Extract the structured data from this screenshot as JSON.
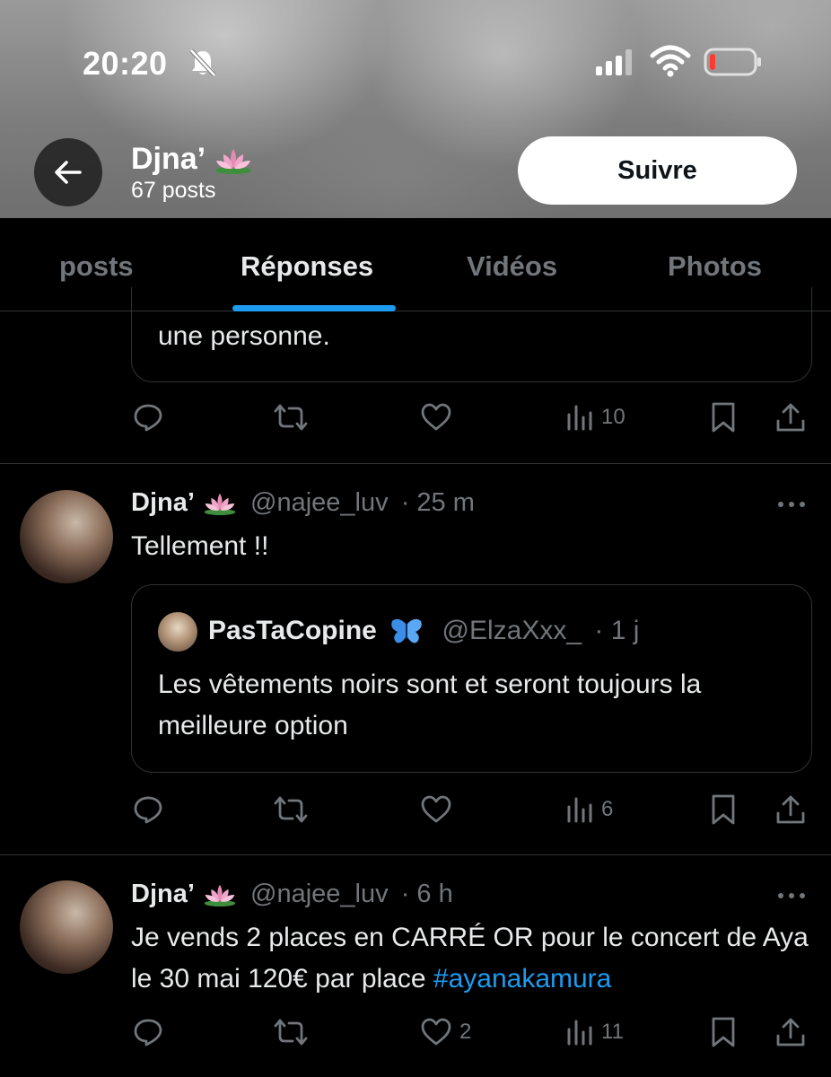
{
  "status_bar": {
    "time": "20:20"
  },
  "profile": {
    "name": "Djna’",
    "posts_count": "67 posts",
    "follow_label": "Suivre"
  },
  "tabs": [
    {
      "label": "posts",
      "active": false
    },
    {
      "label": "Réponses",
      "active": true
    },
    {
      "label": "Vidéos",
      "active": false
    },
    {
      "label": "Photos",
      "active": false
    }
  ],
  "previous_post": {
    "quote_text_tail": "une personne.",
    "views": "10"
  },
  "posts": [
    {
      "name": "Djna’",
      "handle": "@najee_luv",
      "time": "· 25 m",
      "text": "Tellement !!",
      "quote": {
        "name": "PasTaCopine",
        "handle": "@ElzaXxx_",
        "time": "· 1 j",
        "text": "Les vêtements noirs sont et seront toujours la meilleure option"
      },
      "likes": "",
      "views": "6"
    },
    {
      "name": "Djna’",
      "handle": "@najee_luv",
      "time": "· 6 h",
      "text": "Je vends 2 places en CARRÉ OR pour le concert de Aya le 30 mai 120€ par place ",
      "hashtag": "#ayanakamura",
      "likes": "2",
      "views": "11"
    }
  ],
  "colors": {
    "accent": "#1d9bf0",
    "muted": "#71767b",
    "divider": "#2f3336",
    "battery_low": "#ff3b30"
  },
  "icons": [
    "bell-off-icon",
    "signal-icon",
    "wifi-icon",
    "battery-icon",
    "back-arrow-icon",
    "lotus-icon",
    "reply-icon",
    "repost-icon",
    "like-icon",
    "views-icon",
    "bookmark-icon",
    "share-icon",
    "more-icon",
    "butterfly-icon"
  ]
}
